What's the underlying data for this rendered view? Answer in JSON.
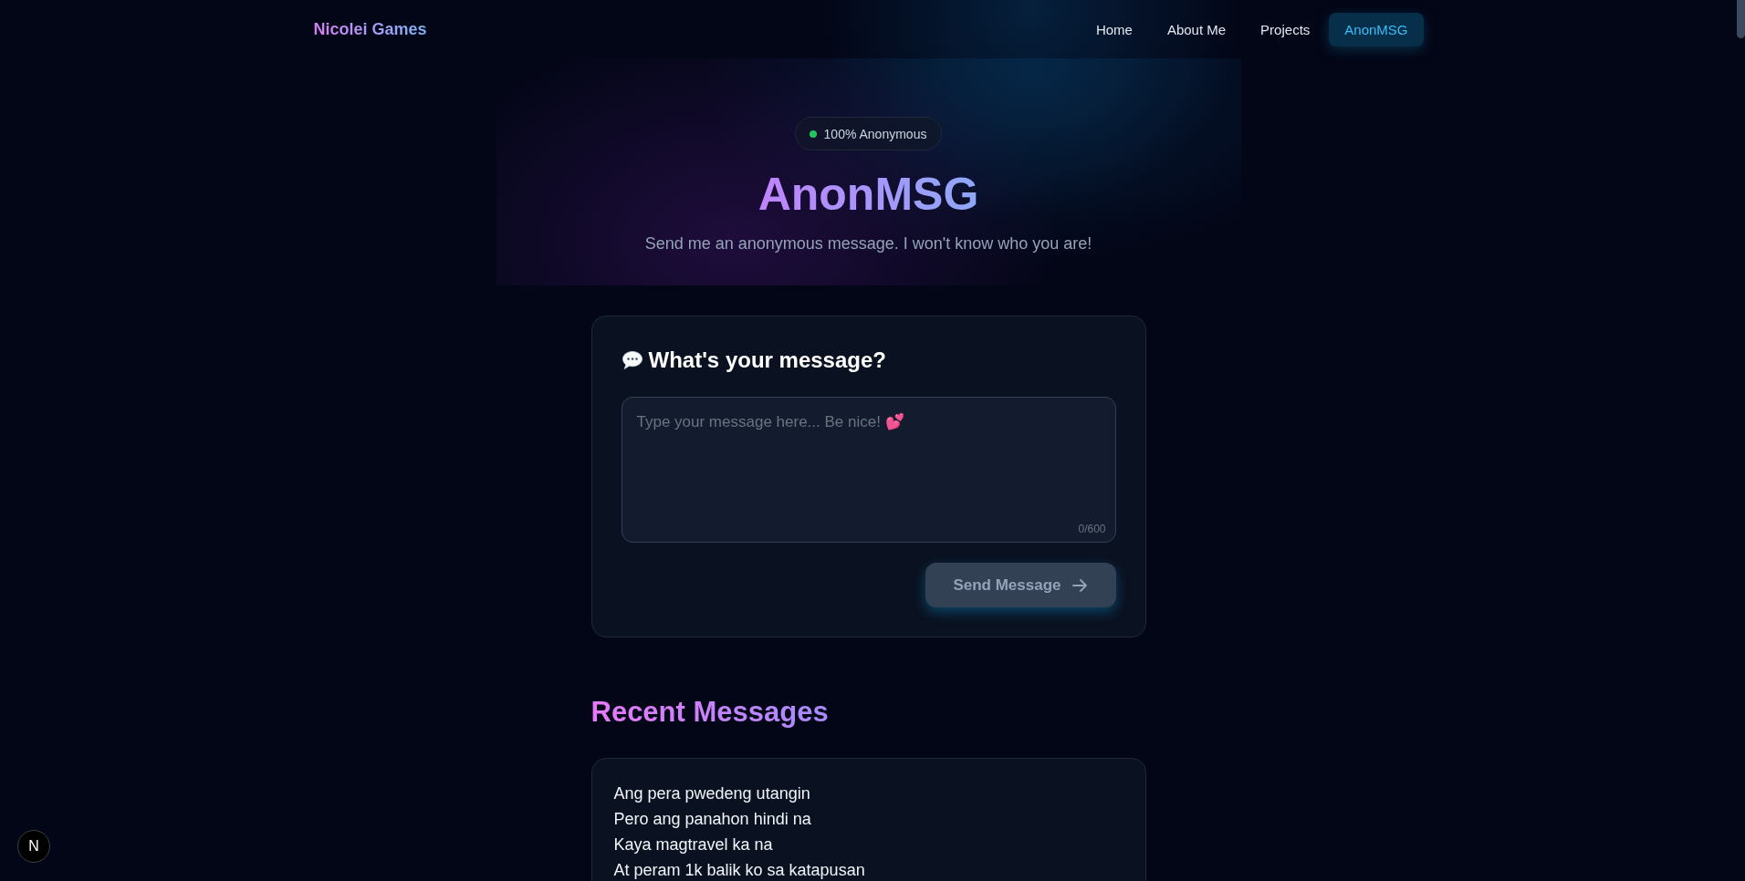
{
  "nav": {
    "brand": "Nicolei Games",
    "links": [
      {
        "label": "Home",
        "selected": false
      },
      {
        "label": "About Me",
        "selected": false
      },
      {
        "label": "Projects",
        "selected": false
      },
      {
        "label": "AnonMSG",
        "selected": true
      }
    ]
  },
  "hero": {
    "badge": "100% Anonymous",
    "title": "AnonMSG",
    "subtitle": "Send me an anonymous message. I won't know who you are!"
  },
  "composer": {
    "heading": "What's your message?",
    "message": {
      "placeholder": "Type your message here... Be nice! 💕"
    },
    "counter": "0/600",
    "send_button": {
      "label": "Send Message",
      "disabled": true
    }
  },
  "recent": {
    "heading": "Recent Messages",
    "messages": [
      {
        "text": "Ang pera pwedeng utangin\nPero ang panahon hindi na\nKaya magtravel ka na\nAt peram 1k balik ko sa katapusan"
      }
    ]
  },
  "corner_button": {
    "label": "N"
  }
}
